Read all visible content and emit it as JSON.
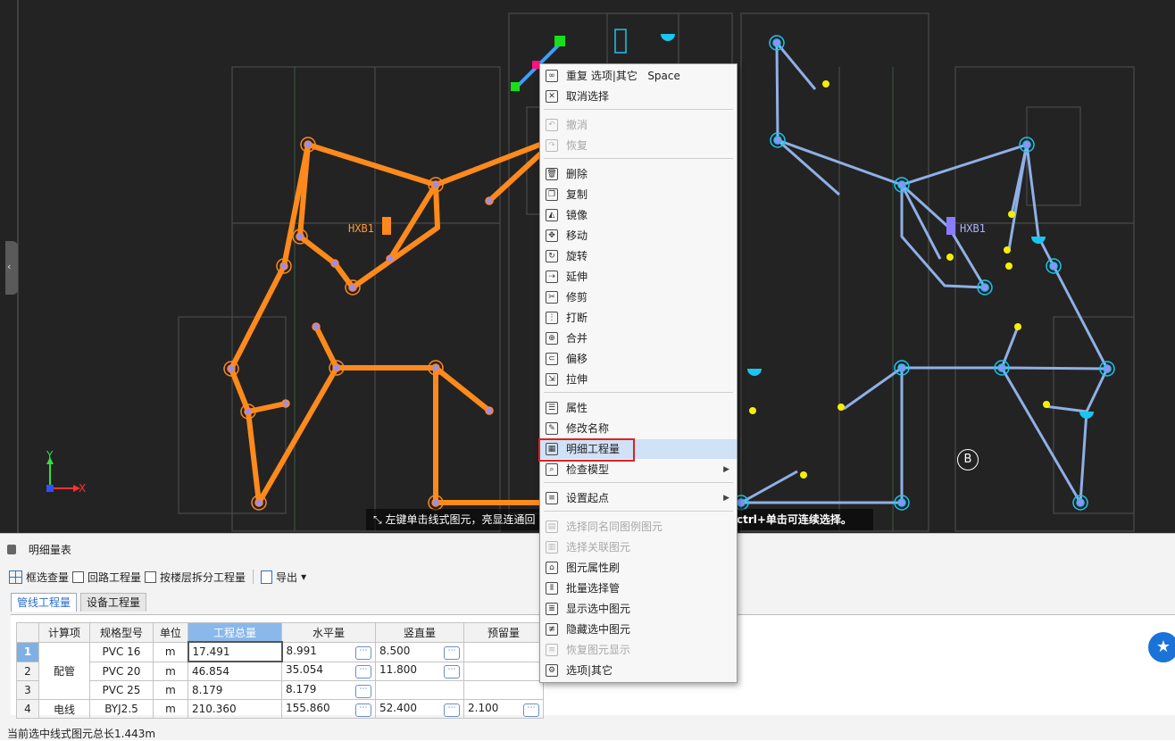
{
  "canvas": {
    "hint_text": "左键单击线式图元，亮显连通回",
    "hint_ctrl_text": "ctrl+单击可连续选择。",
    "label_hxb1_left": "HXB1",
    "label_hxb1_right": "HXB1",
    "axis_y": "Y",
    "axis_x": "X",
    "grid_marker": "B",
    "colors": {
      "background": "#232323",
      "pipe_orange": "#ff8a1c",
      "pipe_blue": "#8fb0e6",
      "cyan": "#19c6f0",
      "yellow": "#f5f000"
    }
  },
  "context_menu": {
    "items": [
      {
        "label": "重复 选项|其它",
        "shortcut": "Space",
        "icon": "repeat-icon",
        "disabled": false
      },
      {
        "label": "取消选择",
        "icon": "cancel-select-icon",
        "disabled": false
      },
      {
        "label": "撤消",
        "icon": "undo-icon",
        "disabled": true
      },
      {
        "label": "恢复",
        "icon": "redo-icon",
        "disabled": true
      },
      {
        "label": "删除",
        "icon": "delete-icon",
        "disabled": false
      },
      {
        "label": "复制",
        "icon": "copy-icon",
        "disabled": false
      },
      {
        "label": "镜像",
        "icon": "mirror-icon",
        "disabled": false
      },
      {
        "label": "移动",
        "icon": "move-icon",
        "disabled": false
      },
      {
        "label": "旋转",
        "icon": "rotate-icon",
        "disabled": false
      },
      {
        "label": "延伸",
        "icon": "extend-icon",
        "disabled": false
      },
      {
        "label": "修剪",
        "icon": "trim-icon",
        "disabled": false
      },
      {
        "label": "打断",
        "icon": "break-icon",
        "disabled": false
      },
      {
        "label": "合并",
        "icon": "merge-icon",
        "disabled": false
      },
      {
        "label": "偏移",
        "icon": "offset-icon",
        "disabled": false
      },
      {
        "label": "拉伸",
        "icon": "stretch-icon",
        "disabled": false
      },
      {
        "label": "属性",
        "icon": "properties-icon",
        "disabled": false
      },
      {
        "label": "修改名称",
        "icon": "rename-icon",
        "disabled": false
      },
      {
        "label": "明细工程量",
        "icon": "detail-quantity-icon",
        "disabled": false,
        "highlighted": true
      },
      {
        "label": "检查模型",
        "icon": "check-model-icon",
        "disabled": false,
        "submenu": true
      },
      {
        "label": "设置起点",
        "icon": "set-start-icon",
        "disabled": false,
        "submenu": true
      },
      {
        "label": "选择同名同图例图元",
        "icon": "select-same-icon",
        "disabled": true
      },
      {
        "label": "选择关联图元",
        "icon": "select-related-icon",
        "disabled": true
      },
      {
        "label": "图元属性刷",
        "icon": "property-brush-icon",
        "disabled": false
      },
      {
        "label": "批量选择管",
        "icon": "batch-select-icon",
        "disabled": false
      },
      {
        "label": "显示选中图元",
        "icon": "show-selected-icon",
        "disabled": false
      },
      {
        "label": "隐藏选中图元",
        "icon": "hide-selected-icon",
        "disabled": false
      },
      {
        "label": "恢复图元显示",
        "icon": "restore-display-icon",
        "disabled": true
      },
      {
        "label": "选项|其它",
        "icon": "options-icon",
        "disabled": false
      }
    ]
  },
  "panel": {
    "title": "明细量表",
    "toolbar": {
      "box_select": "框选查量",
      "loop_quantity": "回路工程量",
      "floor_split": "按楼层拆分工程量",
      "export": "导出"
    },
    "tabs": [
      "管线工程量",
      "设备工程量"
    ],
    "table": {
      "headers": [
        "",
        "计算项",
        "规格型号",
        "单位",
        "工程总量",
        "水平量",
        "竖直量",
        "预留量"
      ],
      "group_pipe": "配管",
      "group_wire": "电线",
      "rows": [
        {
          "idx": "1",
          "spec": "PVC 16",
          "unit": "m",
          "total": "17.491",
          "horizontal": "8.991",
          "vertical": "8.500",
          "reserve": ""
        },
        {
          "idx": "2",
          "spec": "PVC 20",
          "unit": "m",
          "total": "46.854",
          "horizontal": "35.054",
          "vertical": "11.800",
          "reserve": ""
        },
        {
          "idx": "3",
          "spec": "PVC 25",
          "unit": "m",
          "total": "8.179",
          "horizontal": "8.179",
          "vertical": "",
          "reserve": ""
        },
        {
          "idx": "4",
          "spec": "BYJ2.5",
          "unit": "m",
          "total": "210.360",
          "horizontal": "155.860",
          "vertical": "52.400",
          "reserve": "2.100"
        }
      ],
      "dots_label": "⋯"
    },
    "status": "当前选中线式图元总长1.443m"
  }
}
